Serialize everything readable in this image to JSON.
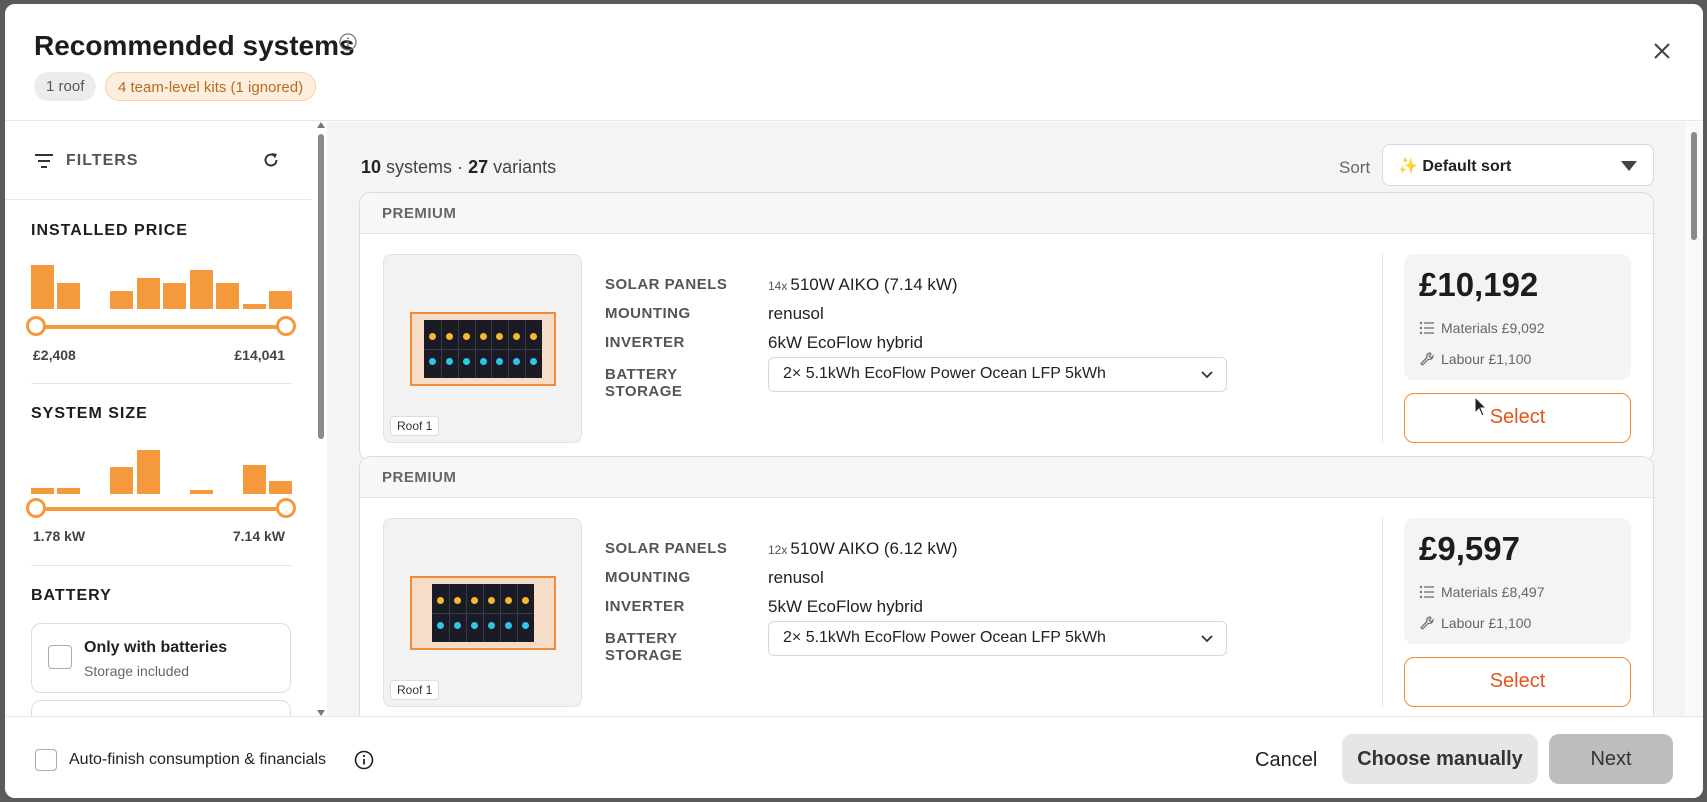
{
  "header": {
    "title": "Recommended systems",
    "pill_roof": "1 roof",
    "pill_kits": "4 team-level kits (1 ignored)"
  },
  "sidebar": {
    "filters_label": "FILTERS",
    "installed_price": {
      "title": "INSTALLED PRICE",
      "min_label": "£2,408",
      "max_label": "£14,041",
      "histogram": [
        100,
        58,
        0,
        40,
        70,
        58,
        88,
        58,
        12,
        42
      ]
    },
    "system_size": {
      "title": "SYSTEM SIZE",
      "min_label": "1.78 kW",
      "max_label": "7.14 kW",
      "histogram": [
        14,
        14,
        0,
        62,
        100,
        0,
        8,
        0,
        66,
        30
      ]
    },
    "battery": {
      "title": "BATTERY",
      "only_batteries_title": "Only with batteries",
      "only_batteries_sub": "Storage included"
    }
  },
  "main": {
    "count_systems": "10",
    "count_systems_word": "systems",
    "sep": "·",
    "count_variants": "27",
    "count_variants_word": "variants",
    "sort_label": "Sort",
    "sort_value": "✨ Default sort",
    "cards": [
      {
        "tier": "PREMIUM",
        "roof_label": "Roof 1",
        "panel_cols": 7,
        "solar_key": "SOLAR PANELS",
        "solar_mult": "14x",
        "solar_value": "510W AIKO (7.14 kW)",
        "mounting_key": "MOUNTING",
        "mounting_value": "renusol",
        "inverter_key": "INVERTER",
        "inverter_value": "6kW EcoFlow hybrid",
        "battery_key_1": "BATTERY",
        "battery_key_2": "STORAGE",
        "battery_value": "2× 5.1kWh EcoFlow Power Ocean LFP 5kWh",
        "price": "£10,192",
        "materials": "Materials £9,092",
        "labour": "Labour £1,100",
        "select_label": "Select"
      },
      {
        "tier": "PREMIUM",
        "roof_label": "Roof 1",
        "panel_cols": 6,
        "solar_key": "SOLAR PANELS",
        "solar_mult": "12x",
        "solar_value": "510W AIKO (6.12 kW)",
        "mounting_key": "MOUNTING",
        "mounting_value": "renusol",
        "inverter_key": "INVERTER",
        "inverter_value": "5kW EcoFlow hybrid",
        "battery_key_1": "BATTERY",
        "battery_key_2": "STORAGE",
        "battery_value": "2× 5.1kWh EcoFlow Power Ocean LFP 5kWh",
        "price": "£9,597",
        "materials": "Materials £8,497",
        "labour": "Labour £1,100",
        "select_label": "Select"
      }
    ]
  },
  "footer": {
    "auto_finish_label": "Auto-finish consumption & financials",
    "cancel_label": "Cancel",
    "choose_manually_label": "Choose manually",
    "next_label": "Next"
  },
  "colors": {
    "accent": "#f59a3c",
    "select_text": "#e0561c",
    "panel_dot_top": "#f5b82e",
    "panel_dot_bottom": "#2ec5e8"
  }
}
